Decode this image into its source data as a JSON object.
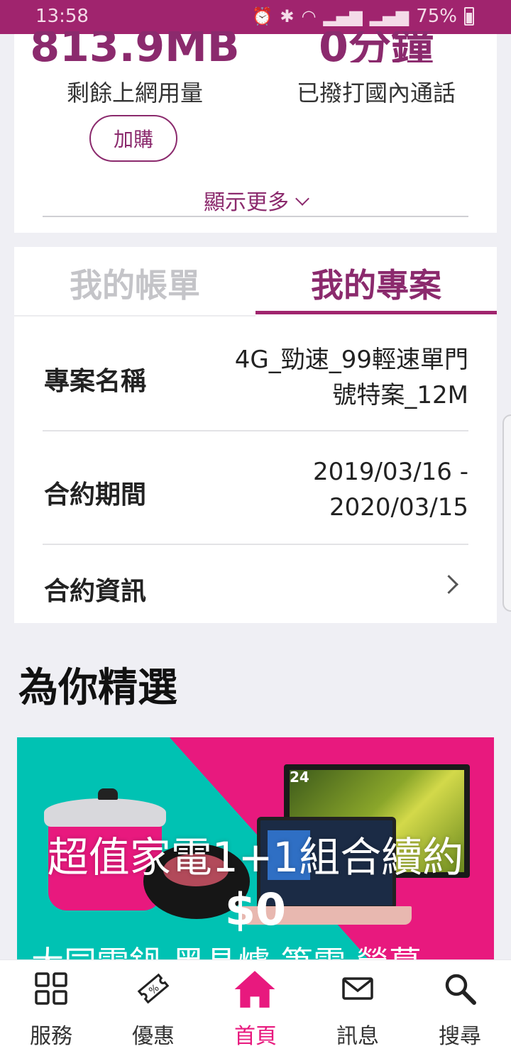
{
  "status_bar": {
    "time": "13:58",
    "battery": "75%"
  },
  "usage": {
    "data_value": "813.9MB",
    "data_label": "剩餘上網用量",
    "call_value": "0分鐘",
    "call_label": "已撥打國內通話",
    "buy_button": "加購",
    "show_more": "顯示更多"
  },
  "plan_tabs": {
    "bills": "我的帳單",
    "plan": "我的專案"
  },
  "plan": {
    "name_label": "專案名稱",
    "name_value_line1": "4G_勁速_99輕速單門",
    "name_value_line2": "號特案_12M",
    "period_label": "合約期間",
    "period_value_line1": "2019/03/16 -",
    "period_value_line2": "2020/03/15",
    "info_label": "合約資訊"
  },
  "featured": {
    "title": "為你精選",
    "banner_title": "超值家電1+1組合續約",
    "banner_price": "$0",
    "banner_subtitle": "大同電鍋‧黑晶爐‧筆電‧螢幕",
    "monitor_size": "24"
  },
  "bottom_nav": [
    {
      "label": "服務",
      "icon": "grid-icon"
    },
    {
      "label": "優惠",
      "icon": "coupon-icon"
    },
    {
      "label": "首頁",
      "icon": "home-icon"
    },
    {
      "label": "訊息",
      "icon": "mail-icon"
    },
    {
      "label": "搜尋",
      "icon": "search-icon"
    }
  ],
  "colors": {
    "brand": "#a0246e",
    "accent_pink": "#e8197e",
    "teal": "#00c2b3"
  }
}
